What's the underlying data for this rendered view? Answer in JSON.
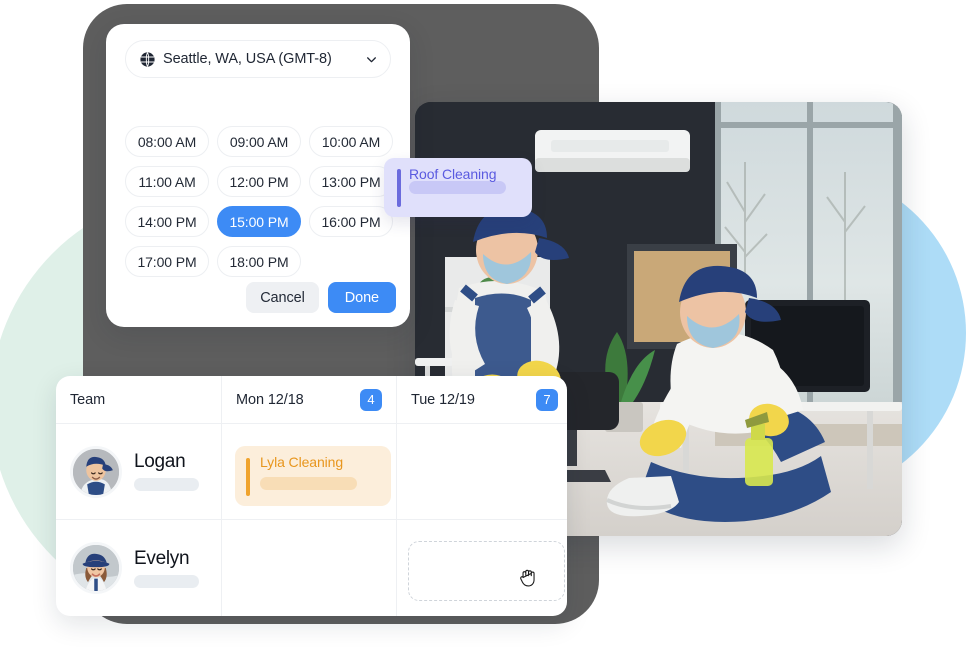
{
  "timepicker": {
    "timezone": {
      "icon": "globe-icon",
      "label": "Seattle, WA, USA (GMT-8)",
      "chevron": "chevron-down-icon"
    },
    "slots": [
      {
        "label": "08:00 AM",
        "selected": false
      },
      {
        "label": "09:00 AM",
        "selected": false
      },
      {
        "label": "10:00 AM",
        "selected": false
      },
      {
        "label": "11:00 AM",
        "selected": false
      },
      {
        "label": "12:00 PM",
        "selected": false
      },
      {
        "label": "13:00 PM",
        "selected": false
      },
      {
        "label": "14:00 PM",
        "selected": false
      },
      {
        "label": "15:00 PM",
        "selected": true
      },
      {
        "label": "16:00 PM",
        "selected": false
      },
      {
        "label": "17:00 PM",
        "selected": false
      },
      {
        "label": "18:00 PM",
        "selected": false
      }
    ],
    "cancel_label": "Cancel",
    "done_label": "Done",
    "accent_color": "#3d8bf5"
  },
  "schedule": {
    "columns": [
      {
        "label": "Team",
        "badge": null
      },
      {
        "label": "Mon 12/18",
        "badge": "4"
      },
      {
        "label": "Tue 12/19",
        "badge": "7"
      }
    ],
    "rows": [
      {
        "name": "Logan",
        "avatar": "avatar-logan",
        "monday_task": {
          "title": "Lyla Cleaning",
          "color": "#e8961e"
        },
        "tuesday_task": null
      },
      {
        "name": "Evelyn",
        "avatar": "avatar-evelyn",
        "monday_task": null,
        "tuesday_task": {
          "title": "Roof Cleaning",
          "color": "#5a5ae0"
        }
      }
    ],
    "badge_color": "#3d8bf5",
    "dragging_card": "Roof Cleaning",
    "cursor": "grabbing-hand-cursor"
  },
  "decor": {
    "mint_circle": "#dff0e8",
    "blue_circle": "#addcf7",
    "device_frame": "#5e5e5e"
  },
  "photo": {
    "alt": "two cleaners in blue uniforms cleaning an office"
  }
}
